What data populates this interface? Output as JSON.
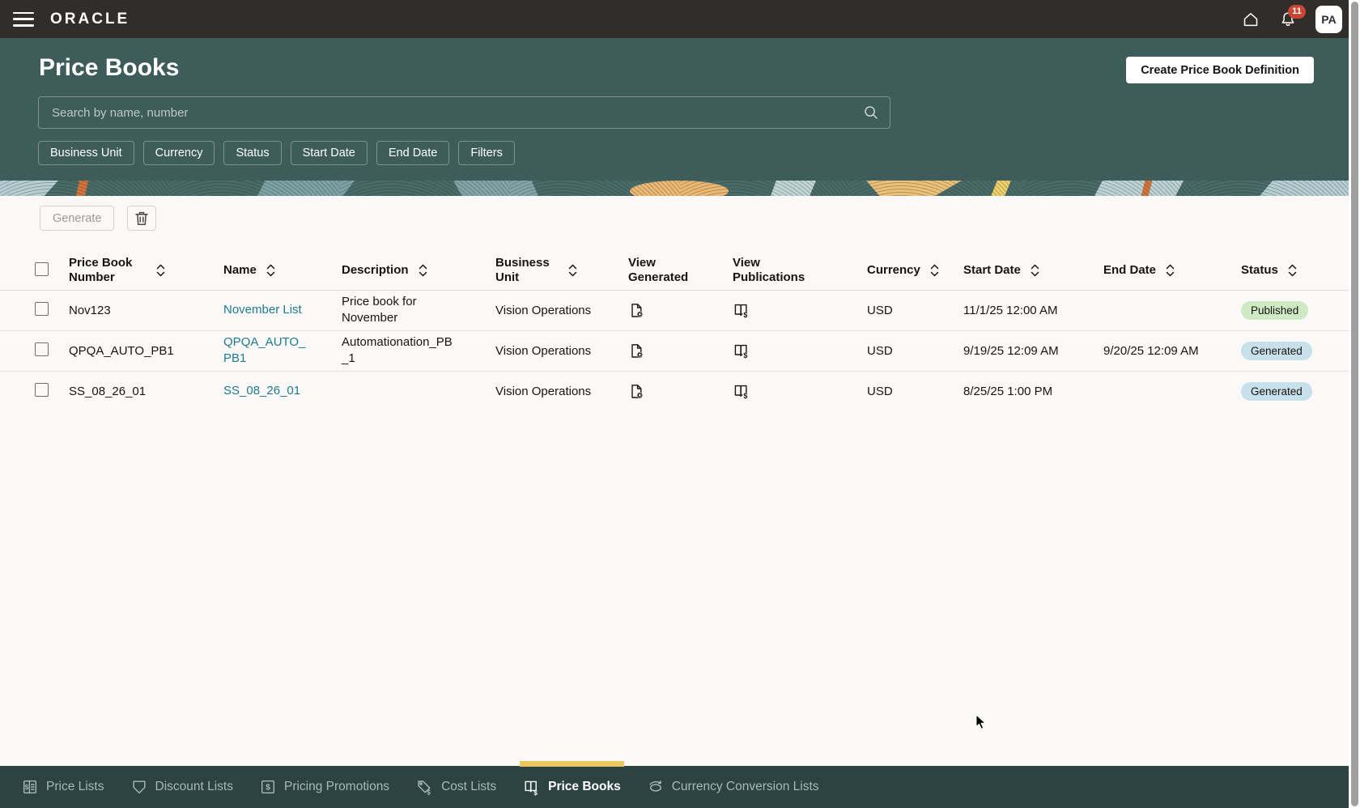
{
  "topbar": {
    "logo": "ORACLE",
    "notification_count": "11",
    "avatar_initials": "PA"
  },
  "header": {
    "title": "Price Books",
    "create_button_label": "Create Price Book Definition",
    "search_placeholder": "Search by name, number",
    "filters": [
      {
        "label": "Business Unit"
      },
      {
        "label": "Currency"
      },
      {
        "label": "Status"
      },
      {
        "label": "Start Date"
      },
      {
        "label": "End Date"
      },
      {
        "label": "Filters"
      }
    ]
  },
  "toolbar": {
    "generate_label": "Generate"
  },
  "table": {
    "columns": [
      {
        "label": "Price Book Number",
        "sortable": true
      },
      {
        "label": "Name",
        "sortable": true
      },
      {
        "label": "Description",
        "sortable": true
      },
      {
        "label": "Business Unit",
        "sortable": true
      },
      {
        "label": "View Generated",
        "sortable": false
      },
      {
        "label": "View Publications",
        "sortable": false
      },
      {
        "label": "Currency",
        "sortable": true
      },
      {
        "label": "Start Date",
        "sortable": true
      },
      {
        "label": "End Date",
        "sortable": true
      },
      {
        "label": "Status",
        "sortable": true
      }
    ],
    "rows": [
      {
        "price_book_number": "Nov123",
        "name": "November List",
        "description": "Price book for November",
        "business_unit": "Vision Operations",
        "currency": "USD",
        "start_date": "11/1/25 12:00 AM",
        "end_date": "",
        "status": "Published"
      },
      {
        "price_book_number": "QPQA_AUTO_PB1",
        "name": "QPQA_AUTO_PB1",
        "description": "Automationation_PB_1",
        "business_unit": "Vision Operations",
        "currency": "USD",
        "start_date": "9/19/25 12:09 AM",
        "end_date": "9/20/25 12:09 AM",
        "status": "Generated"
      },
      {
        "price_book_number": "SS_08_26_01",
        "name": "SS_08_26_01",
        "description": "",
        "business_unit": "Vision Operations",
        "currency": "USD",
        "start_date": "8/25/25 1:00 PM",
        "end_date": "",
        "status": "Generated"
      }
    ]
  },
  "bottom_nav": {
    "items": [
      {
        "label": "Price Lists",
        "active": false
      },
      {
        "label": "Discount Lists",
        "active": false
      },
      {
        "label": "Pricing Promotions",
        "active": false
      },
      {
        "label": "Cost Lists",
        "active": false
      },
      {
        "label": "Price Books",
        "active": true
      },
      {
        "label": "Currency Conversion Lists",
        "active": false
      }
    ]
  },
  "icons": {
    "view_generated": "document-gear",
    "view_publications": "book-dollar",
    "price_lists": "list-dollar",
    "discount_lists": "tag",
    "pricing_promotions": "square-dollar",
    "cost_lists": "tag-dollar",
    "price_books": "book-dollar",
    "currency_conversion_lists": "coin-rotate"
  },
  "colors": {
    "topbar_bg": "#312D2A",
    "header_bg": "#3E5C5A",
    "nav_bg": "#2C4341",
    "page_bg": "#FBF9F8",
    "active_tab_indicator": "#ECC65E",
    "notification_badge": "#C74634",
    "link": "#1D7A8F",
    "badge_published_bg": "#CFE9C4",
    "badge_generated_bg": "#C8E0EA"
  }
}
